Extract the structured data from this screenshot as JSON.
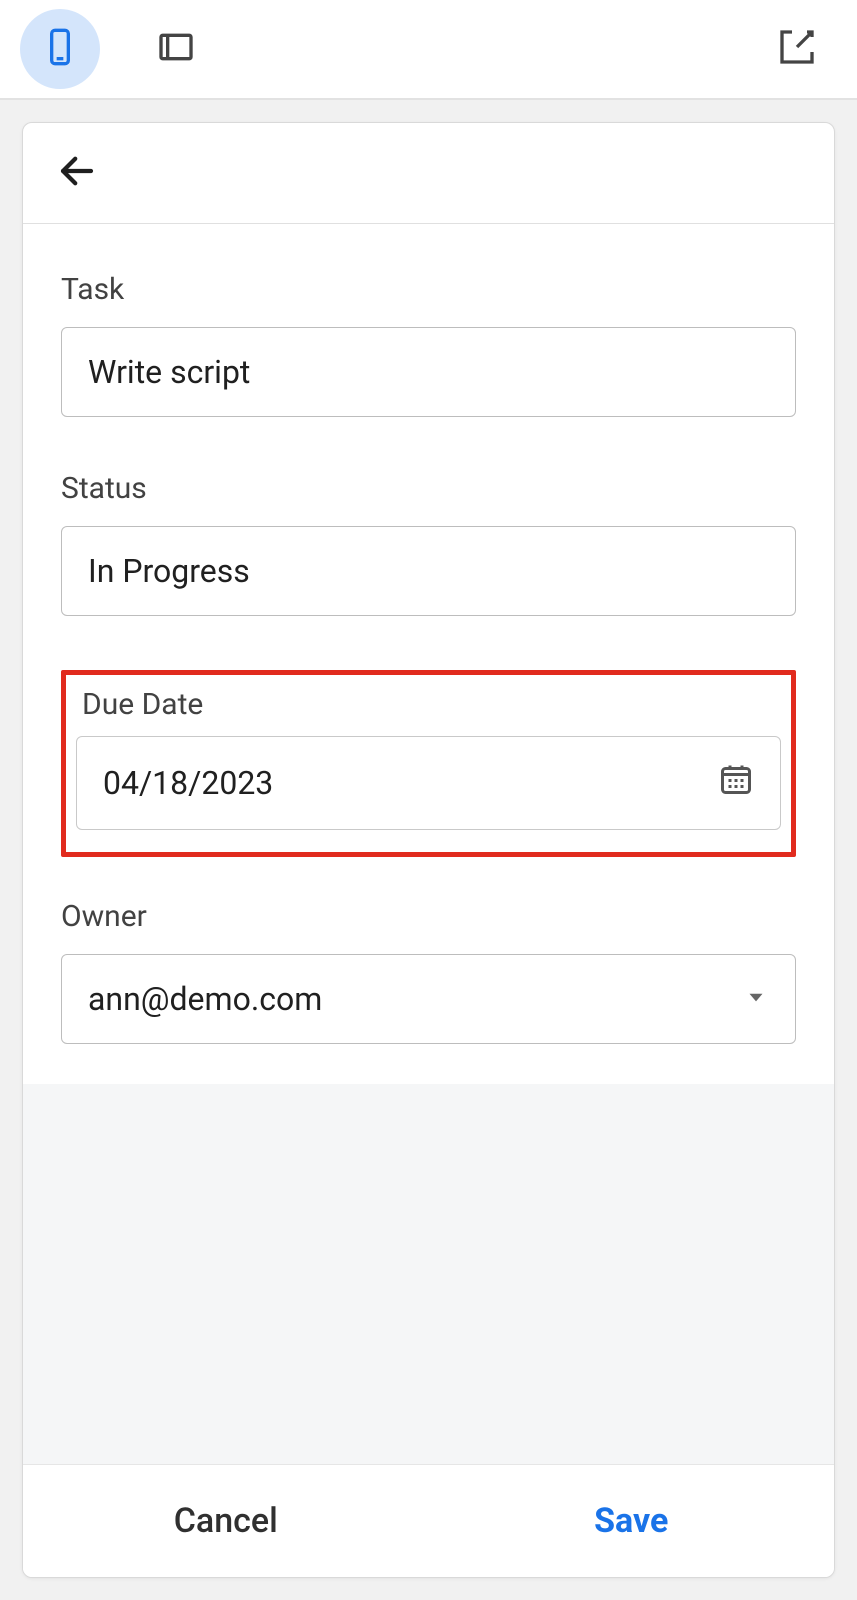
{
  "toolbar": {
    "mobile_icon": "mobile-icon",
    "tablet_icon": "tablet-icon",
    "external_icon": "external-link-icon"
  },
  "form": {
    "task": {
      "label": "Task",
      "value": "Write script"
    },
    "status": {
      "label": "Status",
      "value": "In Progress"
    },
    "due_date": {
      "label": "Due Date",
      "value": "04/18/2023"
    },
    "owner": {
      "label": "Owner",
      "value": "ann@demo.com"
    }
  },
  "footer": {
    "cancel_label": "Cancel",
    "save_label": "Save"
  }
}
